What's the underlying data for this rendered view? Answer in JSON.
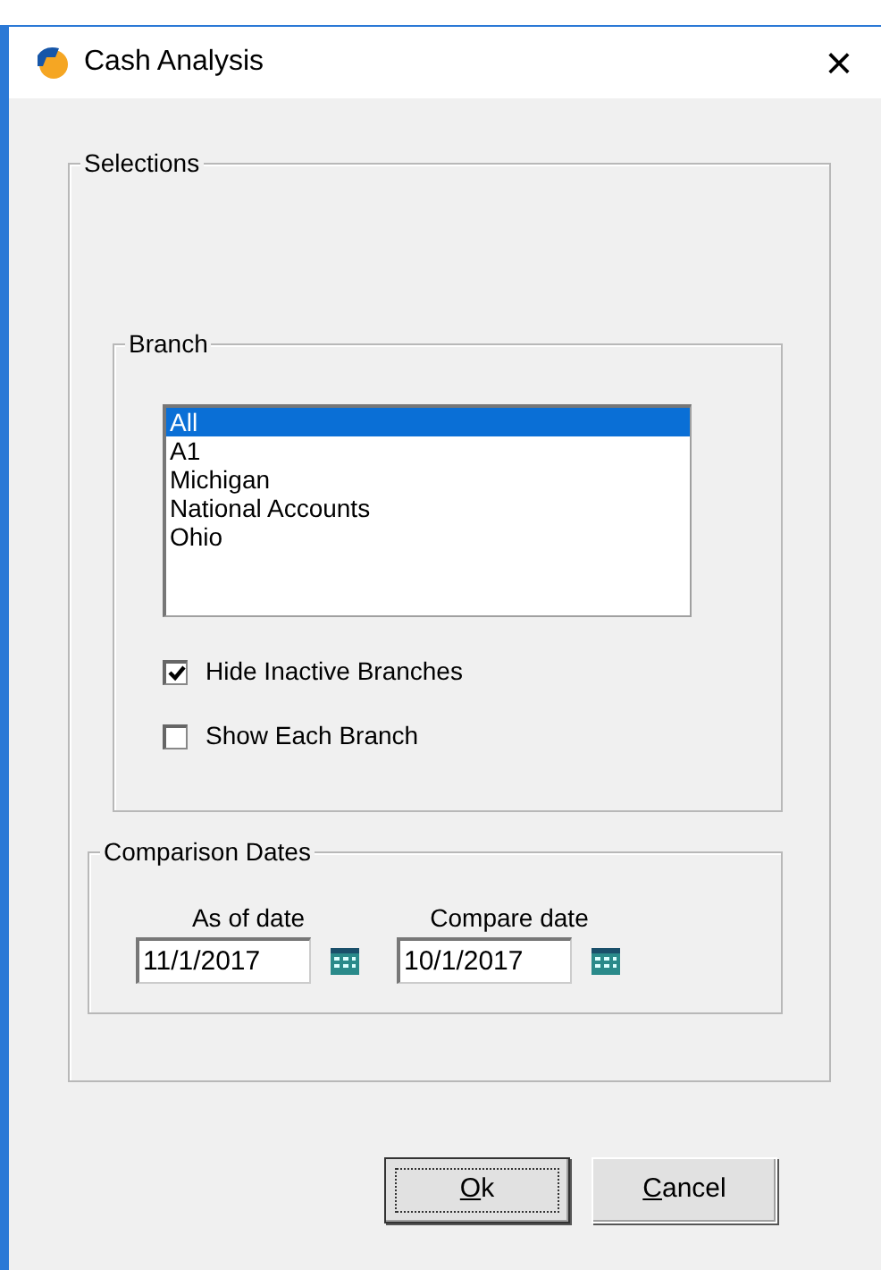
{
  "window": {
    "title": "Cash Analysis",
    "close": "×"
  },
  "selections": {
    "legend": "Selections",
    "branch": {
      "legend": "Branch",
      "items": [
        {
          "label": "All",
          "selected": true
        },
        {
          "label": "A1",
          "selected": false
        },
        {
          "label": "Michigan",
          "selected": false
        },
        {
          "label": "National Accounts",
          "selected": false
        },
        {
          "label": "Ohio",
          "selected": false
        }
      ],
      "options": [
        {
          "label": "Hide Inactive Branches",
          "checked": true
        },
        {
          "label": "Show Each Branch",
          "checked": false
        }
      ]
    },
    "comparison": {
      "legend": "Comparison Dates",
      "fields": [
        {
          "label": "As of date",
          "value": "11/1/2017"
        },
        {
          "label": "Compare date",
          "value": "10/1/2017"
        }
      ]
    }
  },
  "buttons": [
    {
      "label": "Ok",
      "default": true,
      "underline_first": true
    },
    {
      "label": "Cancel",
      "default": false,
      "underline_first": true
    }
  ]
}
